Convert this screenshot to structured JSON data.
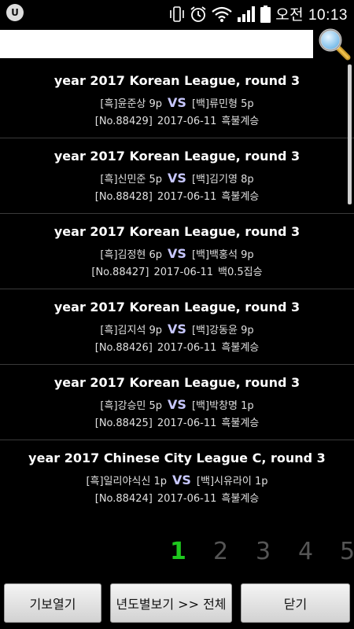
{
  "status": {
    "app_badge": "U",
    "clock": "오전 10:13"
  },
  "search": {
    "value": "",
    "placeholder": ""
  },
  "games": [
    {
      "title": "year 2017 Korean League, round 3",
      "black": "[흑]윤준상 9p",
      "vs": "VS",
      "white": "[백]류민형 5p",
      "no": "[No.88429]",
      "date": "2017-06-11",
      "result": "흑불계승"
    },
    {
      "title": "year 2017 Korean League, round 3",
      "black": "[흑]신민준 5p",
      "vs": "VS",
      "white": "[백]김기영 8p",
      "no": "[No.88428]",
      "date": "2017-06-11",
      "result": "흑불계승"
    },
    {
      "title": "year 2017 Korean League, round 3",
      "black": "[흑]김정현 6p",
      "vs": "VS",
      "white": "[백]백홍석 9p",
      "no": "[No.88427]",
      "date": "2017-06-11",
      "result": "백0.5집승"
    },
    {
      "title": "year 2017 Korean League, round 3",
      "black": "[흑]김지석 9p",
      "vs": "VS",
      "white": "[백]강동윤 9p",
      "no": "[No.88426]",
      "date": "2017-06-11",
      "result": "흑불계승"
    },
    {
      "title": "year 2017 Korean League, round 3",
      "black": "[흑]강승민 5p",
      "vs": "VS",
      "white": "[백]박창명 1p",
      "no": "[No.88425]",
      "date": "2017-06-11",
      "result": "흑불계승"
    },
    {
      "title": "year 2017 Chinese City League C, round 3",
      "black": "[흑]일리야식신 1p",
      "vs": "VS",
      "white": "[백]시유라이 1p",
      "no": "[No.88424]",
      "date": "2017-06-11",
      "result": "흑불계승"
    }
  ],
  "pager": {
    "pages": [
      "1",
      "2",
      "3",
      "4",
      "5"
    ],
    "current": "1",
    "active_color": "#1ec81e"
  },
  "buttons": {
    "open": "기보열기",
    "year_view": "년도별보기 >> 전체",
    "close": "닫기"
  }
}
